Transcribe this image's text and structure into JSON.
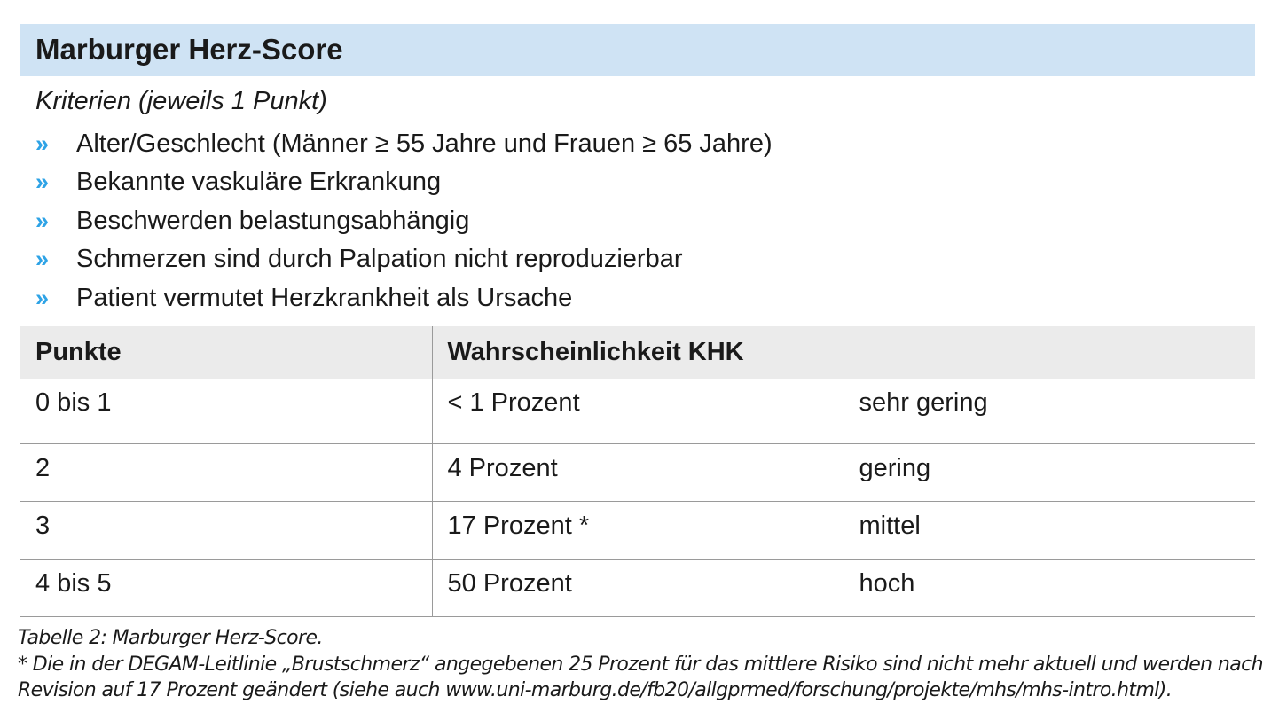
{
  "title": "Marburger Herz-Score",
  "criteria": {
    "heading": "Kriterien (jeweils 1 Punkt)",
    "bullet_glyph": "»",
    "bullet_color": "#2ea3e6",
    "items": [
      "Alter/Geschlecht (Männer ≥ 55 Jahre und Frauen ≥ 65 Jahre)",
      "Bekannte vaskuläre Erkrankung",
      "Beschwerden belastungsabhängig",
      "Schmerzen sind durch Palpation nicht reproduzierbar",
      "Patient vermutet Herzkrankheit als Ursache"
    ]
  },
  "table": {
    "headers": [
      "Punkte",
      "Wahrscheinlichkeit KHK"
    ],
    "rows": [
      [
        "0 bis 1",
        "< 1 Prozent",
        "sehr gering"
      ],
      [
        "2",
        "4 Prozent",
        "gering"
      ],
      [
        "3",
        "17 Prozent *",
        "mittel"
      ],
      [
        "4 bis 5",
        "50 Prozent",
        "hoch"
      ]
    ]
  },
  "caption": {
    "line1": "Tabelle 2: Marburger Herz-Score.",
    "line2": "* Die in der DEGAM-Leitlinie „Brustschmerz“ angegebenen 25 Prozent für das mittlere Risiko sind nicht mehr aktuell und werden nach",
    "line3": "Revision auf 17 Prozent geändert (siehe auch www.uni-marburg.de/fb20/allgprmed/forschung/projekte/mhs/mhs-intro.html)."
  },
  "colors": {
    "title_background": "#cfe3f4",
    "table_header_background": "#ebebeb",
    "rule": "#9a9a9a"
  }
}
